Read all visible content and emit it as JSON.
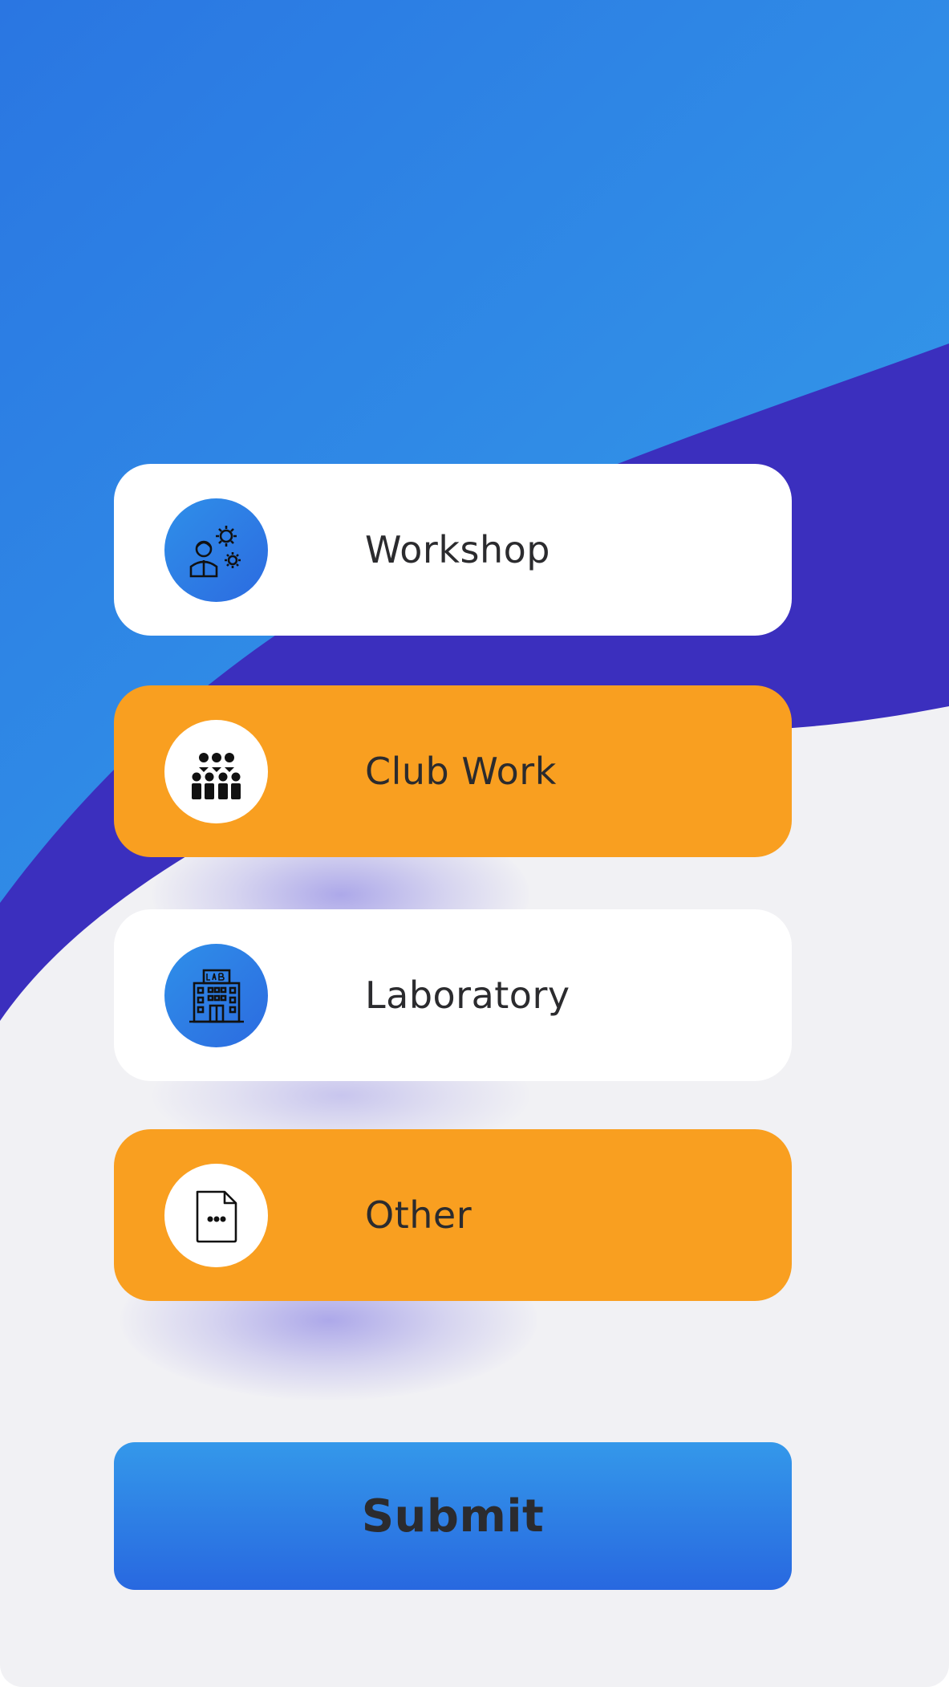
{
  "colors": {
    "background": "#f1f1f4",
    "top_gradient_start": "#2a7be4",
    "top_gradient_end": "#3398e8",
    "wave_indigo": "#3b2fbe",
    "card_white": "#ffffff",
    "card_orange": "#f99f20",
    "submit_top": "#3498ea",
    "submit_bottom": "#2868e0",
    "text": "#2b2b2e"
  },
  "options": [
    {
      "label": "Workshop",
      "icon": "worker-gears-icon",
      "style": "white"
    },
    {
      "label": "Club Work",
      "icon": "group-people-icon",
      "style": "orange"
    },
    {
      "label": "Laboratory",
      "icon": "lab-building-icon",
      "style": "white"
    },
    {
      "label": "Other",
      "icon": "document-more-icon",
      "style": "orange"
    }
  ],
  "submit": {
    "label": "Submit"
  }
}
